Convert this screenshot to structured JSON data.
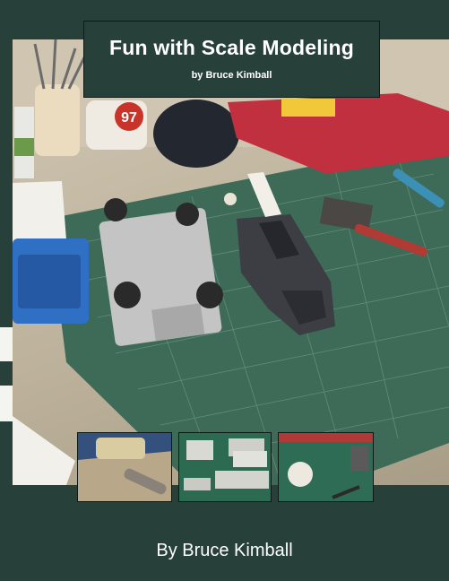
{
  "cover": {
    "title": "Fun with Scale Modeling",
    "byline_small": "by Bruce Kimball",
    "author": "By Bruce Kimball",
    "background_color": "#27403a"
  },
  "photo": {
    "car_number": "97"
  },
  "thumbnails": [
    {
      "name": "thumb-workbench-drill"
    },
    {
      "name": "thumb-sprues-parts"
    },
    {
      "name": "thumb-cutting-mat-tools"
    }
  ]
}
